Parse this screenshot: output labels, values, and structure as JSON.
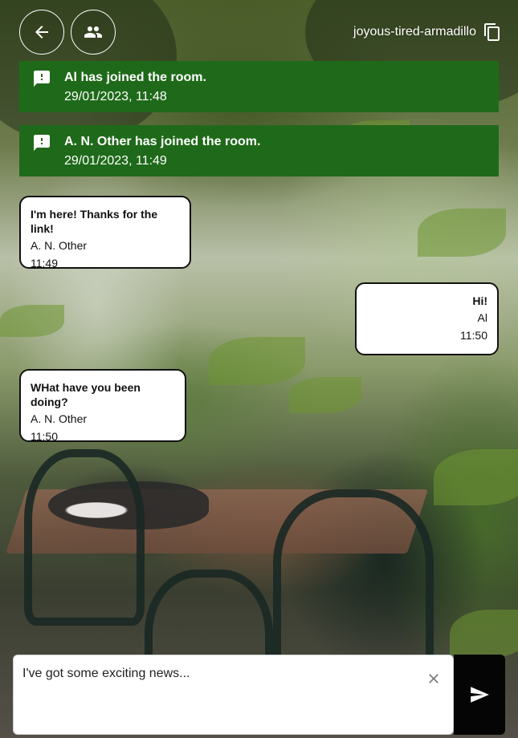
{
  "room": {
    "name": "joyous-tired-armadillo"
  },
  "icons": {
    "back": "arrow-left-icon",
    "participants": "people-icon",
    "copy": "copy-icon",
    "notice": "feedback-chat-icon",
    "clear": "close-icon",
    "send": "send-icon"
  },
  "colors": {
    "notice_bg": "#1f6a1a",
    "bubble_bg": "#ffffff",
    "send_bg": "#050505"
  },
  "notices": [
    {
      "text": "Al has joined the room.",
      "timestamp": "29/01/2023, 11:48"
    },
    {
      "text": "A. N. Other has joined the room.",
      "timestamp": "29/01/2023, 11:49"
    }
  ],
  "messages": [
    {
      "text": "I'm here! Thanks for the link!",
      "author": "A. N. Other",
      "time": "11:49",
      "side": "left"
    },
    {
      "text": "Hi!",
      "author": "Al",
      "time": "11:50",
      "side": "right"
    },
    {
      "text": "WHat have you been doing?",
      "author": "A. N. Other",
      "time": "11:50",
      "side": "left"
    }
  ],
  "composer": {
    "value": "I've got some exciting news..."
  }
}
